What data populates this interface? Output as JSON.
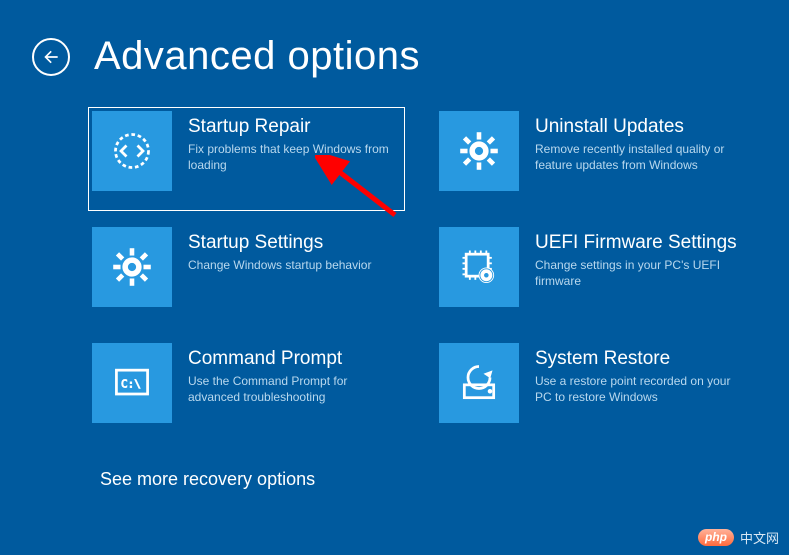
{
  "header": {
    "title": "Advanced options"
  },
  "tiles": [
    {
      "title": "Startup Repair",
      "desc": "Fix problems that keep Windows from loading"
    },
    {
      "title": "Uninstall Updates",
      "desc": "Remove recently installed quality or feature updates from Windows"
    },
    {
      "title": "Startup Settings",
      "desc": "Change Windows startup behavior"
    },
    {
      "title": "UEFI Firmware Settings",
      "desc": "Change settings in your PC's UEFI firmware"
    },
    {
      "title": "Command Prompt",
      "desc": "Use the Command Prompt for advanced troubleshooting"
    },
    {
      "title": "System Restore",
      "desc": "Use a restore point recorded on your PC to restore Windows"
    }
  ],
  "more_link": "See more recovery options",
  "watermark": {
    "pill": "php",
    "text": "中文网"
  },
  "colors": {
    "bg": "#005a9e",
    "tile": "#2899e0",
    "desc": "#b8d8ee"
  }
}
